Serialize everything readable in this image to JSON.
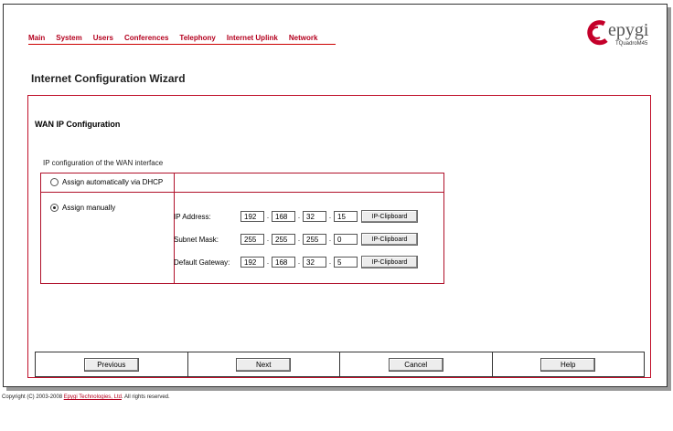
{
  "nav": {
    "items": [
      "Main",
      "System",
      "Users",
      "Conferences",
      "Telephony",
      "Internet Uplink",
      "Network"
    ]
  },
  "logo": {
    "brand": "epygi",
    "model": "TQuadroM45"
  },
  "page": {
    "title": "Internet Configuration Wizard",
    "section_title": "WAN IP Configuration",
    "ip_config_label": "IP configuration of the WAN interface"
  },
  "options": {
    "dhcp_label": "Assign automatically via DHCP",
    "manual_label": "Assign manually",
    "selected": "manual"
  },
  "fields": {
    "ip_address": {
      "label": "IP Address:",
      "octets": [
        "192",
        "168",
        "32",
        "15"
      ]
    },
    "subnet_mask": {
      "label": "Subnet Mask:",
      "octets": [
        "255",
        "255",
        "255",
        "0"
      ]
    },
    "default_gateway": {
      "label": "Default Gateway:",
      "octets": [
        "192",
        "168",
        "32",
        "5"
      ]
    },
    "clipboard_label": "IP-Clipboard"
  },
  "buttons": {
    "previous": "Previous",
    "next": "Next",
    "cancel": "Cancel",
    "help": "Help"
  },
  "footer": {
    "prefix": "Copyright (C) 2003-2008 ",
    "company": "Epygi Technologies, Ltd",
    "suffix": ". All rights reserved."
  },
  "colors": {
    "accent": "#b4001e",
    "frame": "#333333"
  }
}
